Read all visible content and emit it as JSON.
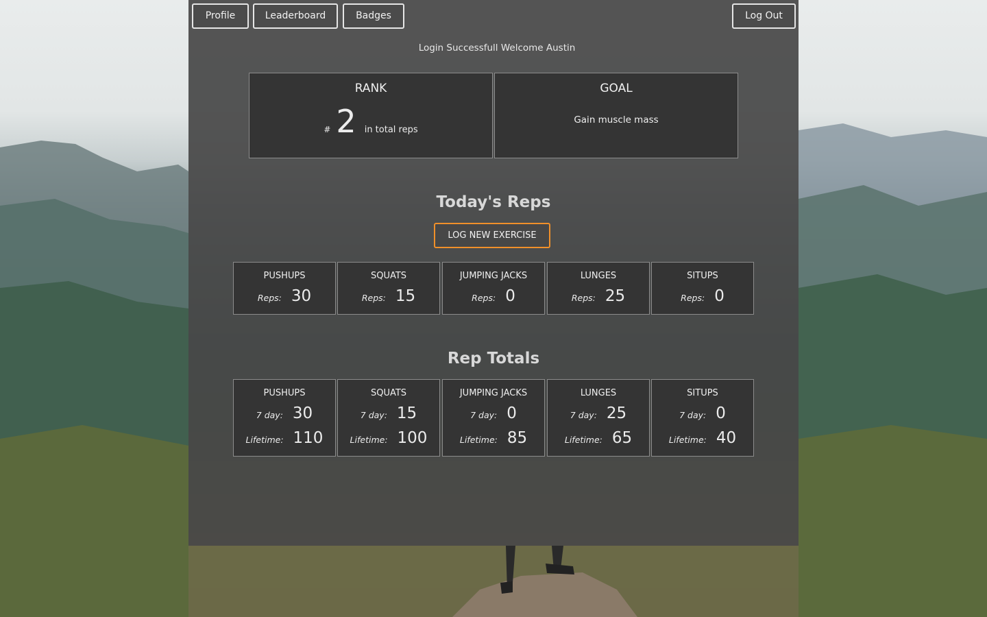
{
  "nav": {
    "profile_label": "Profile",
    "leaderboard_label": "Leaderboard",
    "badges_label": "Badges",
    "logout_label": "Log Out"
  },
  "welcome_message": "Login Successfull Welcome Austin",
  "rank": {
    "title": "RANK",
    "hash": "#",
    "value": "2",
    "suffix": "in total reps"
  },
  "goal": {
    "title": "GOAL",
    "text": "Gain muscle mass"
  },
  "today": {
    "title": "Today's Reps",
    "log_button_label": "LOG NEW EXERCISE",
    "reps_label": "Reps:",
    "exercises": [
      {
        "name": "PUSHUPS",
        "reps": "30"
      },
      {
        "name": "SQUATS",
        "reps": "15"
      },
      {
        "name": "JUMPING JACKS",
        "reps": "0"
      },
      {
        "name": "LUNGES",
        "reps": "25"
      },
      {
        "name": "SITUPS",
        "reps": "0"
      }
    ]
  },
  "totals": {
    "title": "Rep Totals",
    "seven_day_label": "7 day:",
    "lifetime_label": "Lifetime:",
    "exercises": [
      {
        "name": "PUSHUPS",
        "seven_day": "30",
        "lifetime": "110"
      },
      {
        "name": "SQUATS",
        "seven_day": "15",
        "lifetime": "100"
      },
      {
        "name": "JUMPING JACKS",
        "seven_day": "0",
        "lifetime": "85"
      },
      {
        "name": "LUNGES",
        "seven_day": "25",
        "lifetime": "65"
      },
      {
        "name": "SITUPS",
        "seven_day": "0",
        "lifetime": "40"
      }
    ]
  }
}
